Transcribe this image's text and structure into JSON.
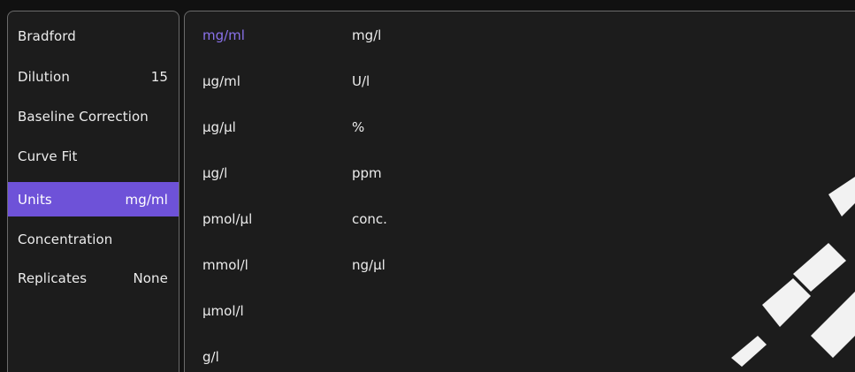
{
  "sidebar": {
    "items": [
      {
        "label": "Bradford",
        "value": ""
      },
      {
        "label": "Dilution",
        "value": "15"
      },
      {
        "label": "Baseline Correction",
        "value": ""
      },
      {
        "label": "Curve Fit",
        "value": ""
      },
      {
        "label": "Units",
        "value": "mg/ml"
      },
      {
        "label": "Concentration",
        "value": ""
      },
      {
        "label": "Replicates",
        "value": "None"
      }
    ],
    "active_index": 4
  },
  "units": {
    "column1": [
      "mg/ml",
      "µg/ml",
      "µg/µl",
      "µg/l",
      "pmol/µl",
      "mmol/l",
      "µmol/l",
      "g/l"
    ],
    "column2": [
      "mg/l",
      "U/l",
      "%",
      "ppm",
      "conc.",
      "ng/µl"
    ],
    "selected": "mg/ml"
  },
  "colors": {
    "accent": "#6e52d8",
    "selected_text": "#8a72ec",
    "panel_bg": "#1c1c1c",
    "border": "#6a6a6a"
  }
}
